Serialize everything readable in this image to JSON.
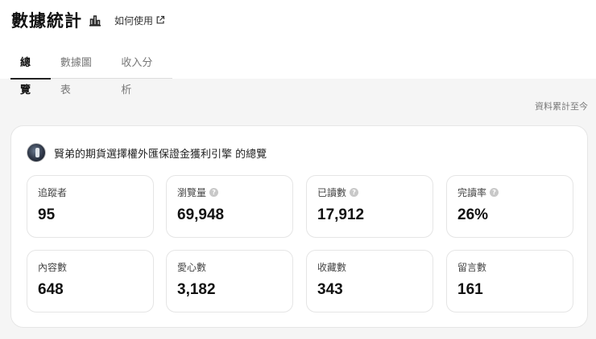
{
  "header": {
    "title": "數據統計",
    "chart_icon": "bar-chart-icon",
    "howto_label": "如何使用",
    "howto_icon": "external-link-icon"
  },
  "tabs": [
    {
      "label": "總覽",
      "active": true
    },
    {
      "label": "數據圖表",
      "active": false
    },
    {
      "label": "收入分析",
      "active": false
    }
  ],
  "cumulative_note": "資料累計至今",
  "card": {
    "title": "賢弟的期貨選擇權外匯保證金獲利引擎 的總覽",
    "stats": [
      {
        "label": "追蹤者",
        "value": "95",
        "help": false
      },
      {
        "label": "瀏覽量",
        "value": "69,948",
        "help": true
      },
      {
        "label": "已讀數",
        "value": "17,912",
        "help": true
      },
      {
        "label": "完讀率",
        "value": "26%",
        "help": true
      },
      {
        "label": "內容數",
        "value": "648",
        "help": false
      },
      {
        "label": "愛心數",
        "value": "3,182",
        "help": false
      },
      {
        "label": "收藏數",
        "value": "343",
        "help": false
      },
      {
        "label": "留言數",
        "value": "161",
        "help": false
      }
    ]
  },
  "colors": {
    "background": "#f5f5f5",
    "card": "#ffffff",
    "border": "#e5e5e5",
    "active_tab_underline": "#222222",
    "help_icon": "#c8c8c8"
  }
}
